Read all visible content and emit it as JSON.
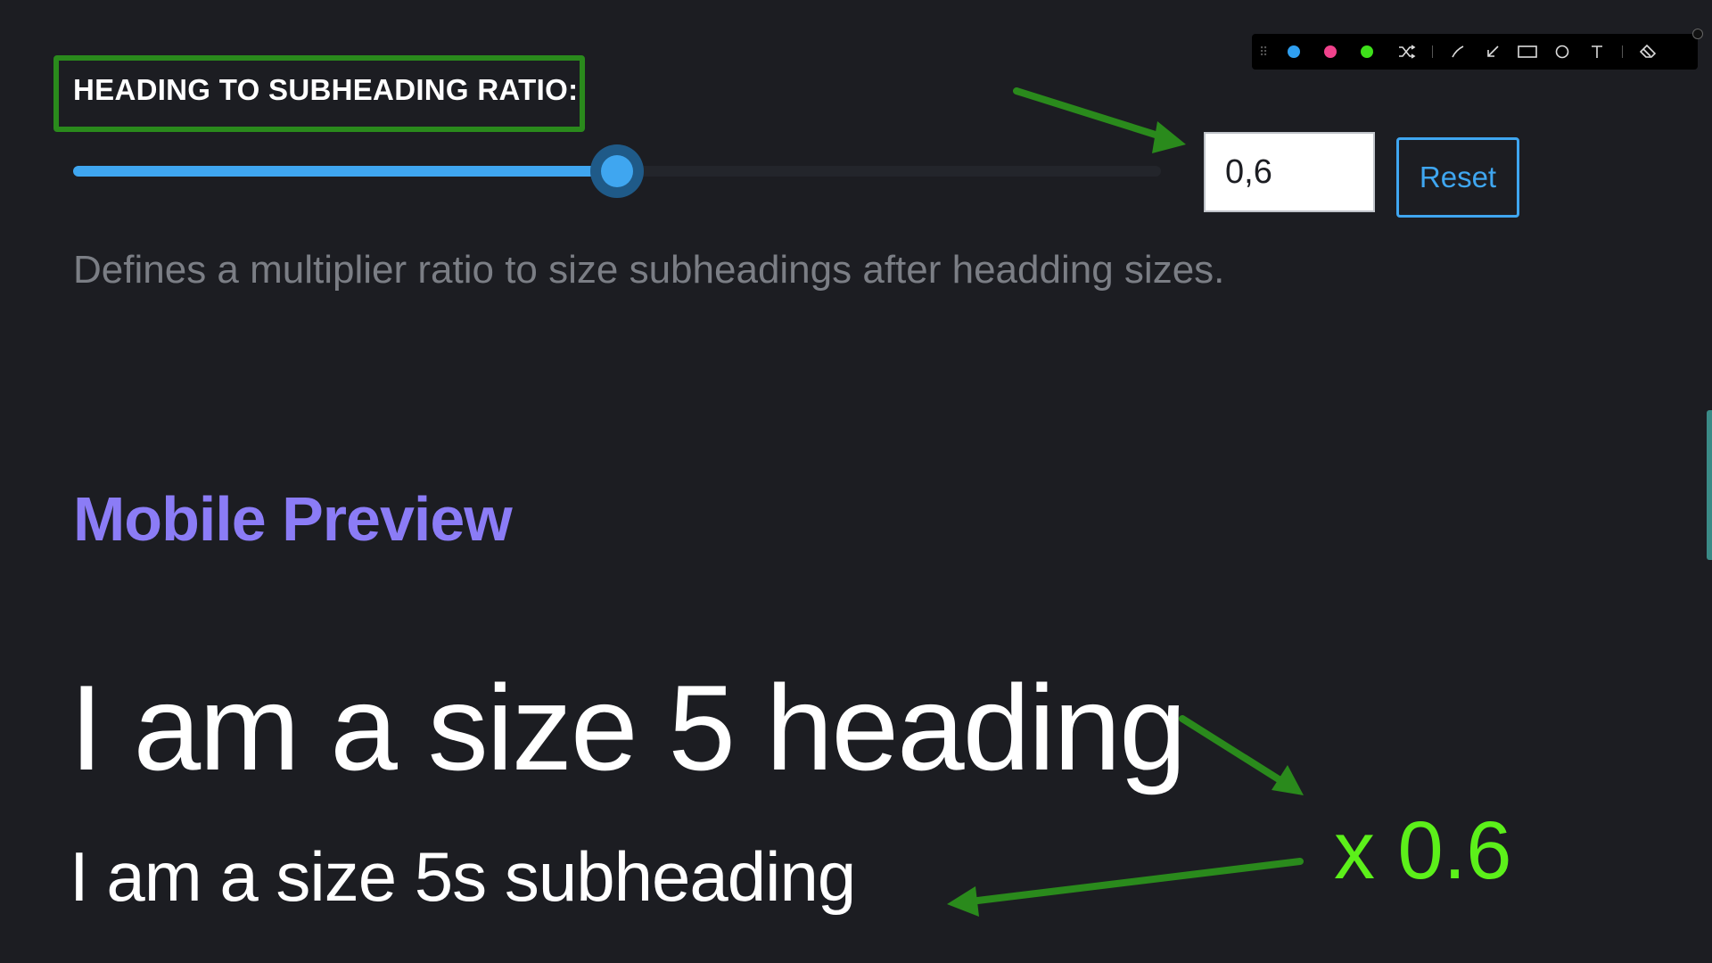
{
  "setting": {
    "label": "HEADING TO SUBHEADING RATIO:",
    "slider_value": 0.6,
    "slider_fraction": 0.5,
    "input_value": "0,6",
    "reset_label": "Reset",
    "help_text": "Defines a multiplier ratio to size subheadings after headding sizes."
  },
  "preview": {
    "title": "Mobile Preview",
    "heading": "I am a size 5 heading",
    "subheading": "I am a size 5s subheading"
  },
  "annotation": {
    "multiplier_text": "x 0.6"
  },
  "toolbar": {
    "colors": [
      "#2f9ff0",
      "#f0428c",
      "#3ee01a"
    ],
    "tools": [
      "shuffle-icon",
      "line-icon",
      "arrow-icon",
      "rectangle-icon",
      "circle-icon",
      "text-icon",
      "eraser-icon"
    ]
  },
  "colors": {
    "accent_blue": "#3fa6f0",
    "preview_title": "#8b7cf6",
    "annotation_green": "#2a8a1c",
    "multiplier_green": "#5cf01a"
  }
}
